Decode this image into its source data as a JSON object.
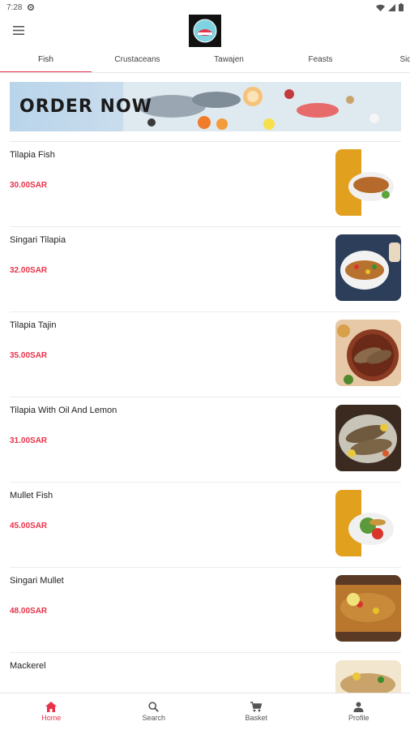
{
  "status_bar": {
    "time": "7:28"
  },
  "tabs": [
    "Fish",
    "Crustaceans",
    "Tawajen",
    "Feasts",
    "Side D"
  ],
  "banner": {
    "text": "ORDER NOW"
  },
  "items": [
    {
      "name": "Tilapia Fish",
      "price": "30.00SAR"
    },
    {
      "name": "Singari Tilapia",
      "price": "32.00SAR"
    },
    {
      "name": "Tilapia Tajin",
      "price": "35.00SAR"
    },
    {
      "name": "Tilapia With Oil And Lemon",
      "price": "31.00SAR"
    },
    {
      "name": "Mullet Fish",
      "price": "45.00SAR"
    },
    {
      "name": "Singari Mullet",
      "price": "48.00SAR"
    },
    {
      "name": "Mackerel",
      "price": ""
    }
  ],
  "bottom_nav": [
    {
      "label": "Home",
      "icon": "home-icon"
    },
    {
      "label": "Search",
      "icon": "search-icon"
    },
    {
      "label": "Basket",
      "icon": "cart-icon"
    },
    {
      "label": "Profile",
      "icon": "profile-icon"
    }
  ],
  "colors": {
    "accent": "#e8334a",
    "divider": "#ececec"
  }
}
